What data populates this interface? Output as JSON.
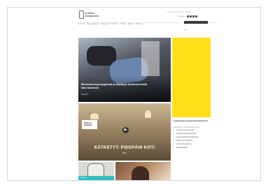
{
  "header": {
    "logo_text_line1": "kirkko",
    "logo_text_line2": "kaupunki",
    "top_links": "0400 0000 000 0000",
    "social_label": "Seuraa",
    "social_icons": [
      "facebook-icon",
      "twitter-icon",
      "instagram-icon",
      "youtube-icon"
    ]
  },
  "nav": {
    "items": [
      "Etusivu",
      "Ajankohtaista",
      "Kaupunki",
      "Kulttuuri",
      "Kirkko",
      "Elämä",
      "Podcast"
    ]
  },
  "search": {
    "placeholder": "Hae"
  },
  "hero": {
    "title": "Mielenterveysongelmat ja köyhyys kulkevat usein käsi kädessä",
    "tag": "Kaupunki"
  },
  "video_card": {
    "board_text": "kirkko ja kaupunki",
    "play": "▶",
    "title": "KÄTKETYT: POISPÄIN KOTI",
    "subtitle": "Video"
  },
  "sidebar": {
    "heading": "Luetuimmat ja kommentoiduimmat",
    "tabs": "Luetuimmat · Kommentoiduimmat",
    "items": [
      {
        "num": "1",
        "text": "Kolumni: Älä anna periksi"
      },
      {
        "num": "2",
        "text": "Seurakuntavaalit lähestyvät"
      },
      {
        "num": "3",
        "text": "Joulun tapahtumat Helsingissä"
      },
      {
        "num": "4",
        "text": "Pappi kertoo arjestaan"
      },
      {
        "num": "5",
        "text": "Uusi kirkko valmistuu"
      },
      {
        "num": "6",
        "text": "Kirjeitä lukijoilta"
      }
    ]
  },
  "small_card": {
    "label": "Podcast"
  },
  "ad": {
    "color": "#ffe01a"
  }
}
